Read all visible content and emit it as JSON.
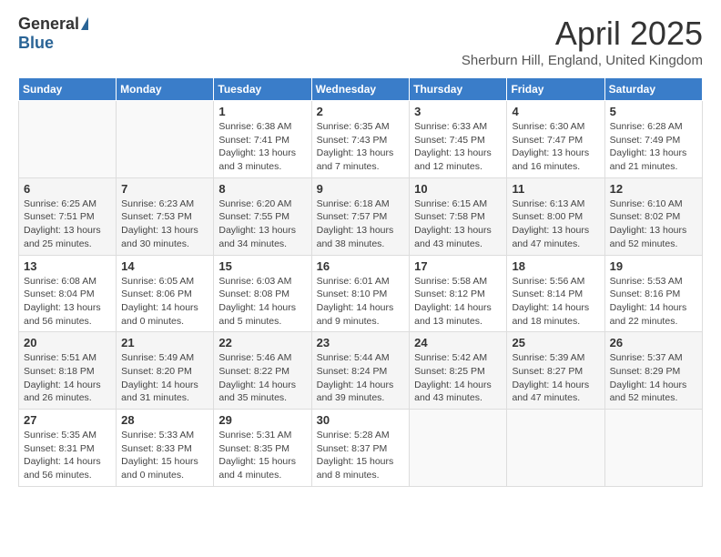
{
  "header": {
    "logo_general": "General",
    "logo_blue": "Blue",
    "month_title": "April 2025",
    "location": "Sherburn Hill, England, United Kingdom"
  },
  "weekdays": [
    "Sunday",
    "Monday",
    "Tuesday",
    "Wednesday",
    "Thursday",
    "Friday",
    "Saturday"
  ],
  "weeks": [
    [
      {
        "day": "",
        "info": ""
      },
      {
        "day": "",
        "info": ""
      },
      {
        "day": "1",
        "info": "Sunrise: 6:38 AM\nSunset: 7:41 PM\nDaylight: 13 hours and 3 minutes."
      },
      {
        "day": "2",
        "info": "Sunrise: 6:35 AM\nSunset: 7:43 PM\nDaylight: 13 hours and 7 minutes."
      },
      {
        "day": "3",
        "info": "Sunrise: 6:33 AM\nSunset: 7:45 PM\nDaylight: 13 hours and 12 minutes."
      },
      {
        "day": "4",
        "info": "Sunrise: 6:30 AM\nSunset: 7:47 PM\nDaylight: 13 hours and 16 minutes."
      },
      {
        "day": "5",
        "info": "Sunrise: 6:28 AM\nSunset: 7:49 PM\nDaylight: 13 hours and 21 minutes."
      }
    ],
    [
      {
        "day": "6",
        "info": "Sunrise: 6:25 AM\nSunset: 7:51 PM\nDaylight: 13 hours and 25 minutes."
      },
      {
        "day": "7",
        "info": "Sunrise: 6:23 AM\nSunset: 7:53 PM\nDaylight: 13 hours and 30 minutes."
      },
      {
        "day": "8",
        "info": "Sunrise: 6:20 AM\nSunset: 7:55 PM\nDaylight: 13 hours and 34 minutes."
      },
      {
        "day": "9",
        "info": "Sunrise: 6:18 AM\nSunset: 7:57 PM\nDaylight: 13 hours and 38 minutes."
      },
      {
        "day": "10",
        "info": "Sunrise: 6:15 AM\nSunset: 7:58 PM\nDaylight: 13 hours and 43 minutes."
      },
      {
        "day": "11",
        "info": "Sunrise: 6:13 AM\nSunset: 8:00 PM\nDaylight: 13 hours and 47 minutes."
      },
      {
        "day": "12",
        "info": "Sunrise: 6:10 AM\nSunset: 8:02 PM\nDaylight: 13 hours and 52 minutes."
      }
    ],
    [
      {
        "day": "13",
        "info": "Sunrise: 6:08 AM\nSunset: 8:04 PM\nDaylight: 13 hours and 56 minutes."
      },
      {
        "day": "14",
        "info": "Sunrise: 6:05 AM\nSunset: 8:06 PM\nDaylight: 14 hours and 0 minutes."
      },
      {
        "day": "15",
        "info": "Sunrise: 6:03 AM\nSunset: 8:08 PM\nDaylight: 14 hours and 5 minutes."
      },
      {
        "day": "16",
        "info": "Sunrise: 6:01 AM\nSunset: 8:10 PM\nDaylight: 14 hours and 9 minutes."
      },
      {
        "day": "17",
        "info": "Sunrise: 5:58 AM\nSunset: 8:12 PM\nDaylight: 14 hours and 13 minutes."
      },
      {
        "day": "18",
        "info": "Sunrise: 5:56 AM\nSunset: 8:14 PM\nDaylight: 14 hours and 18 minutes."
      },
      {
        "day": "19",
        "info": "Sunrise: 5:53 AM\nSunset: 8:16 PM\nDaylight: 14 hours and 22 minutes."
      }
    ],
    [
      {
        "day": "20",
        "info": "Sunrise: 5:51 AM\nSunset: 8:18 PM\nDaylight: 14 hours and 26 minutes."
      },
      {
        "day": "21",
        "info": "Sunrise: 5:49 AM\nSunset: 8:20 PM\nDaylight: 14 hours and 31 minutes."
      },
      {
        "day": "22",
        "info": "Sunrise: 5:46 AM\nSunset: 8:22 PM\nDaylight: 14 hours and 35 minutes."
      },
      {
        "day": "23",
        "info": "Sunrise: 5:44 AM\nSunset: 8:24 PM\nDaylight: 14 hours and 39 minutes."
      },
      {
        "day": "24",
        "info": "Sunrise: 5:42 AM\nSunset: 8:25 PM\nDaylight: 14 hours and 43 minutes."
      },
      {
        "day": "25",
        "info": "Sunrise: 5:39 AM\nSunset: 8:27 PM\nDaylight: 14 hours and 47 minutes."
      },
      {
        "day": "26",
        "info": "Sunrise: 5:37 AM\nSunset: 8:29 PM\nDaylight: 14 hours and 52 minutes."
      }
    ],
    [
      {
        "day": "27",
        "info": "Sunrise: 5:35 AM\nSunset: 8:31 PM\nDaylight: 14 hours and 56 minutes."
      },
      {
        "day": "28",
        "info": "Sunrise: 5:33 AM\nSunset: 8:33 PM\nDaylight: 15 hours and 0 minutes."
      },
      {
        "day": "29",
        "info": "Sunrise: 5:31 AM\nSunset: 8:35 PM\nDaylight: 15 hours and 4 minutes."
      },
      {
        "day": "30",
        "info": "Sunrise: 5:28 AM\nSunset: 8:37 PM\nDaylight: 15 hours and 8 minutes."
      },
      {
        "day": "",
        "info": ""
      },
      {
        "day": "",
        "info": ""
      },
      {
        "day": "",
        "info": ""
      }
    ]
  ]
}
